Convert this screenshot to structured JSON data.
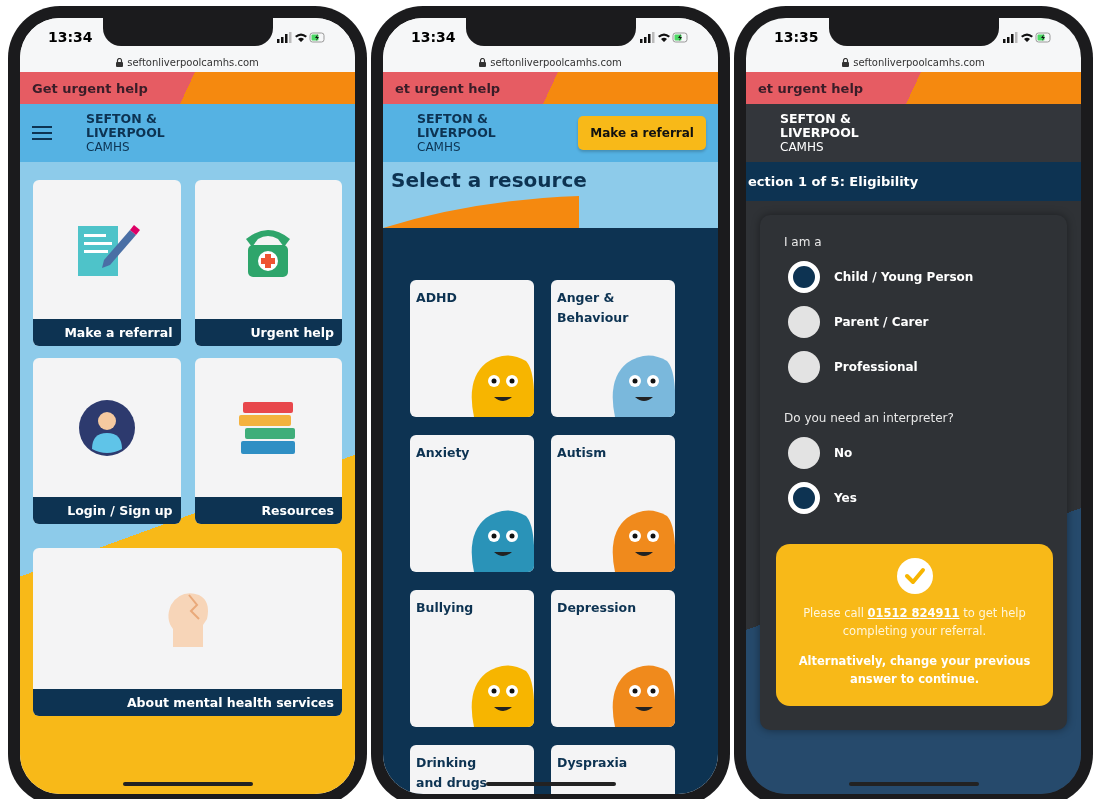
{
  "phones": [
    {
      "kind": "home",
      "time": "13:34",
      "url": "seftonliverpoolcamhs.com",
      "urgent": "Get urgent help",
      "logo": [
        "SEFTON &",
        "LIVERPOOL",
        "CAMHS"
      ],
      "tiles": [
        {
          "kind": "referral",
          "label": "Make a referral"
        },
        {
          "kind": "urgent",
          "label": "Urgent help"
        },
        {
          "kind": "login",
          "label": "Login / Sign up"
        },
        {
          "kind": "resources",
          "label": "Resources"
        },
        {
          "kind": "about",
          "label": "About mental health services"
        }
      ]
    },
    {
      "kind": "resources",
      "time": "13:34",
      "url": "seftonliverpoolcamhs.com",
      "urgent": "et urgent help",
      "logo": [
        "SEFTON &",
        "LIVERPOOL",
        "CAMHS"
      ],
      "button": "Make a referral",
      "heading": "Select a resource",
      "resources": [
        {
          "label": "ADHD",
          "color": "#f7b500"
        },
        {
          "label": "Anger & Behaviour",
          "color": "#7ab8dc"
        },
        {
          "label": "Anxiety",
          "color": "#2a93b8"
        },
        {
          "label": "Autism",
          "color": "#f08a1c"
        },
        {
          "label": "Bullying",
          "color": "#f7b500"
        },
        {
          "label": "Depression",
          "color": "#f08a1c"
        },
        {
          "label": "Drinking and drugs"
        },
        {
          "label": "Dyspraxia"
        }
      ]
    },
    {
      "kind": "form",
      "time": "13:35",
      "url": "seftonliverpoolcamhs.com",
      "urgent": "et urgent help",
      "logo": [
        "SEFTON &",
        "LIVERPOOL",
        "CAMHS"
      ],
      "section": "ection 1 of 5: Eligibility",
      "questions": [
        {
          "label": "I am a",
          "options": [
            {
              "label": "Child / Young Person",
              "selected": true
            },
            {
              "label": "Parent / Carer",
              "selected": false
            },
            {
              "label": "Professional",
              "selected": false
            }
          ]
        },
        {
          "label": "Do you need an interpreter?",
          "options": [
            {
              "label": "No",
              "selected": false
            },
            {
              "label": "Yes",
              "selected": true
            }
          ]
        }
      ],
      "notice": {
        "before": "Please call",
        "phone": "01512 824911",
        "after": "to get help completing your referral.",
        "note": "Alternatively, change your previous answer to continue."
      }
    }
  ]
}
